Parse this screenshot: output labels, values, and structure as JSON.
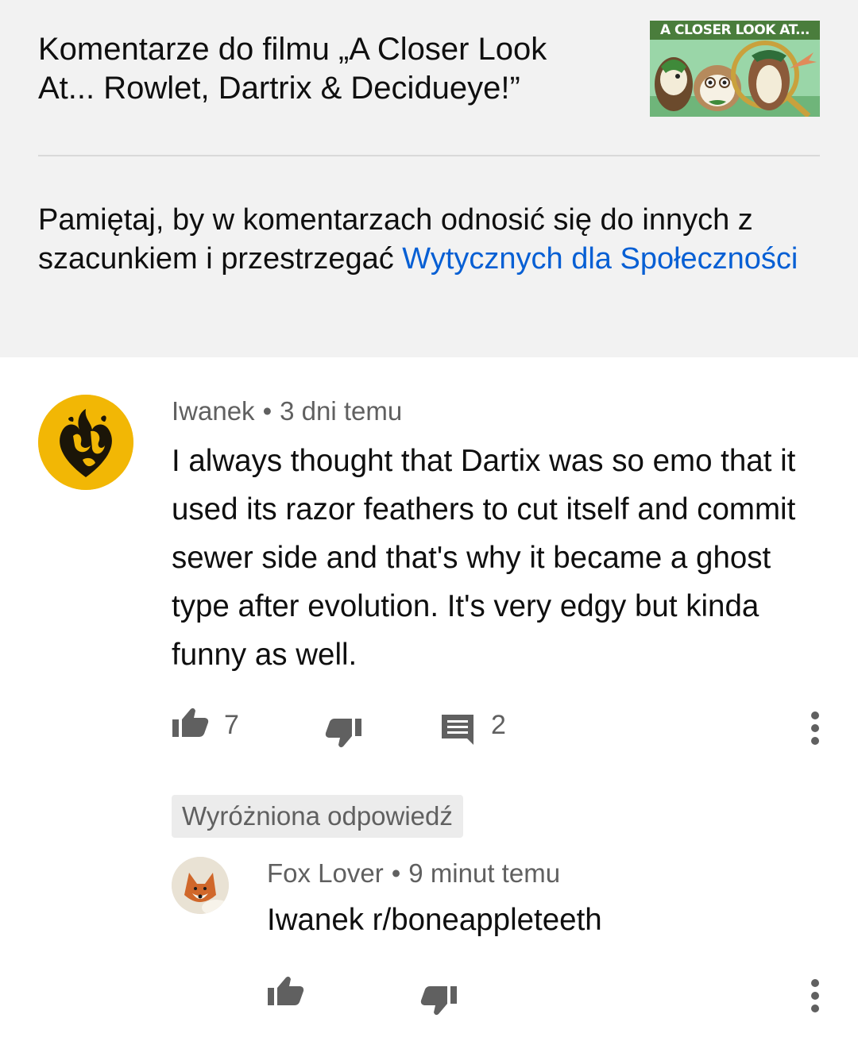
{
  "header": {
    "video_title": "Komentarze do filmu „A Closer Look At... Rowlet, Dartrix & Decidueye!”",
    "thumbnail_banner": "A CLOSER LOOK AT...",
    "guidelines_text": "Pamiętaj, by w komentarzach odnosić się do innych z szacunkiem i przestrzegać ",
    "guidelines_link": "Wytycznych dla Społeczności"
  },
  "comment": {
    "author": "Iwanek",
    "separator": "•",
    "time": "3 dni temu",
    "text": "I always thought that Dartix was so emo that it used its razor feathers to cut itself and commit sewer side and that's why it became a ghost type after evolution. It's very edgy but kinda funny as well.",
    "likes": "7",
    "replies": "2",
    "icons": {
      "like": "thumb-up-icon",
      "dislike": "thumb-down-icon",
      "reply": "comment-icon",
      "menu": "more-vert-icon"
    }
  },
  "highlighted_label": "Wyróżniona odpowiedź",
  "reply": {
    "author": "Fox Lover",
    "separator": "•",
    "time": "9 minut temu",
    "text": "Iwanek r/boneappleteeth"
  },
  "colors": {
    "header_bg": "#f2f2f2",
    "link": "#065fd4",
    "secondary_text": "#606060",
    "avatar_bg": "#f2b705"
  }
}
